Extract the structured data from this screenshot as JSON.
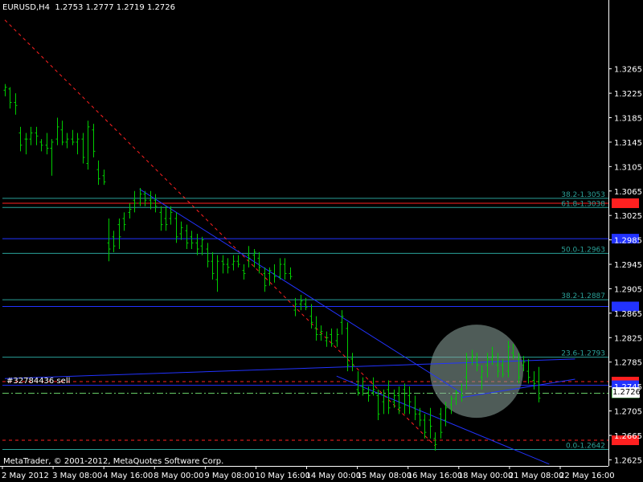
{
  "header": {
    "symbol": "EURUSD,H4",
    "open": "1.2753",
    "high": "1.2777",
    "low": "1.2719",
    "close": "1.2726"
  },
  "copyright": "MetaTrader, © 2001-2012, MetaQuotes Software Corp.",
  "order_label": "#32784436 sell",
  "current_price_label": "1.2726",
  "colors": {
    "background": "#000000",
    "bars": "#00cc00",
    "axis": "#ffffff",
    "fibo_lines": "#2aa198",
    "blue_lines": "#2233ff",
    "red_lines": "#ff2020",
    "highlight_circle": "#8fa8a0"
  },
  "chart_data": {
    "type": "ohlc",
    "symbol": "EURUSD",
    "timeframe": "H4",
    "ylim": [
      1.2615,
      1.3375
    ],
    "y_ticks": [
      "1.3265",
      "1.3225",
      "1.3185",
      "1.3145",
      "1.3105",
      "1.3065",
      "1.3025",
      "1.2985",
      "1.2945",
      "1.2905",
      "1.2865",
      "1.2825",
      "1.2785",
      "1.2745",
      "1.2705",
      "1.2665",
      "1.2625"
    ],
    "x_ticks": [
      "2 May 2012",
      "3 May 08:00",
      "4 May 16:00",
      "8 May 00:00",
      "9 May 08:00",
      "10 May 16:00",
      "14 May 00:00",
      "15 May 08:00",
      "16 May 16:00",
      "18 May 00:00",
      "21 May 08:00",
      "22 May 16:00"
    ],
    "fibonacci_levels": [
      {
        "label": "38.2-1.3053",
        "price": 1.3053
      },
      {
        "label": "61.8-1.3038",
        "price": 1.3038
      },
      {
        "label": "50.0-1.2963",
        "price": 1.2963
      },
      {
        "label": "38.2-1.2887",
        "price": 1.2887
      },
      {
        "label": "23.6-1.2793",
        "price": 1.2793
      },
      {
        "label": "0.0-1.2642",
        "price": 1.2642
      }
    ],
    "horizontal_lines": [
      {
        "price": 1.3045,
        "color": "red",
        "style": "solid"
      },
      {
        "price": 1.2987,
        "color": "blue",
        "style": "solid"
      },
      {
        "price": 1.2876,
        "color": "blue",
        "style": "solid"
      },
      {
        "price": 1.2753,
        "color": "red",
        "style": "dashed"
      },
      {
        "price": 1.2747,
        "color": "blue",
        "style": "solid"
      },
      {
        "price": 1.2734,
        "color": "green",
        "style": "dash-dot"
      },
      {
        "price": 1.2657,
        "color": "red",
        "style": "dashed"
      }
    ],
    "trend_lines": [
      {
        "color": "red",
        "style": "dashed",
        "from": [
          0,
          1.3345
        ],
        "to": [
          83,
          1.2648
        ]
      },
      {
        "color": "blue",
        "style": "solid",
        "from": [
          26,
          1.3068
        ],
        "to": [
          88,
          1.2735
        ]
      },
      {
        "color": "blue",
        "style": "solid",
        "from": [
          0,
          1.2758
        ],
        "to": [
          110,
          1.279
        ]
      },
      {
        "color": "blue",
        "style": "solid",
        "from": [
          64,
          1.2762
        ],
        "to": [
          105,
          1.2618
        ]
      },
      {
        "color": "blue",
        "style": "solid",
        "from": [
          88,
          1.2727
        ],
        "to": [
          110,
          1.2757
        ]
      }
    ],
    "ohlc": [
      [
        1.323,
        1.324,
        1.322,
        1.3235
      ],
      [
        1.3232,
        1.3235,
        1.32,
        1.321
      ],
      [
        1.321,
        1.3225,
        1.319,
        1.3205
      ],
      [
        1.316,
        1.317,
        1.313,
        1.314
      ],
      [
        1.315,
        1.316,
        1.3125,
        1.315
      ],
      [
        1.315,
        1.317,
        1.314,
        1.316
      ],
      [
        1.316,
        1.317,
        1.314,
        1.3155
      ],
      [
        1.3145,
        1.315,
        1.313,
        1.314
      ],
      [
        1.314,
        1.316,
        1.3125,
        1.3135
      ],
      [
        1.3135,
        1.315,
        1.309,
        1.3145
      ],
      [
        1.315,
        1.3185,
        1.314,
        1.317
      ],
      [
        1.3165,
        1.318,
        1.314,
        1.3145
      ],
      [
        1.3145,
        1.316,
        1.3135,
        1.315
      ],
      [
        1.315,
        1.3165,
        1.314,
        1.3145
      ],
      [
        1.3145,
        1.316,
        1.3125,
        1.315
      ],
      [
        1.315,
        1.316,
        1.311,
        1.312
      ],
      [
        1.311,
        1.318,
        1.31,
        1.317
      ],
      [
        1.3165,
        1.3175,
        1.312,
        1.313
      ],
      [
        1.31,
        1.3115,
        1.3075,
        1.3085
      ],
      [
        1.309,
        1.31,
        1.3075,
        1.308
      ],
      [
        1.298,
        1.302,
        1.295,
        1.297
      ],
      [
        1.299,
        1.3,
        1.2965,
        1.2975
      ],
      [
        1.301,
        1.302,
        1.297,
        1.299
      ],
      [
        1.302,
        1.303,
        1.3,
        1.301
      ],
      [
        1.303,
        1.3045,
        1.302,
        1.3035
      ],
      [
        1.305,
        1.3065,
        1.303,
        1.3045
      ],
      [
        1.3045,
        1.307,
        1.304,
        1.306
      ],
      [
        1.306,
        1.3065,
        1.304,
        1.305
      ],
      [
        1.305,
        1.3065,
        1.3035,
        1.3045
      ],
      [
        1.305,
        1.306,
        1.303,
        1.304
      ],
      [
        1.303,
        1.304,
        1.3,
        1.301
      ],
      [
        1.302,
        1.304,
        1.3,
        1.301
      ],
      [
        1.302,
        1.304,
        1.301,
        1.303
      ],
      [
        1.302,
        1.303,
        1.298,
        1.299
      ],
      [
        1.2995,
        1.3015,
        1.2985,
        1.3005
      ],
      [
        1.3,
        1.301,
        1.297,
        1.298
      ],
      [
        1.299,
        1.3,
        1.297,
        1.298
      ],
      [
        1.298,
        1.2995,
        1.296,
        1.297
      ],
      [
        1.2975,
        1.299,
        1.296,
        1.2985
      ],
      [
        1.297,
        1.298,
        1.294,
        1.295
      ],
      [
        1.295,
        1.2965,
        1.292,
        1.293
      ],
      [
        1.292,
        1.296,
        1.29,
        1.295
      ],
      [
        1.295,
        1.296,
        1.293,
        1.2945
      ],
      [
        1.2945,
        1.2955,
        1.293,
        1.294
      ],
      [
        1.2945,
        1.296,
        1.2935,
        1.295
      ],
      [
        1.295,
        1.296,
        1.294,
        1.2945
      ],
      [
        1.2935,
        1.2945,
        1.292,
        1.293
      ],
      [
        1.296,
        1.2975,
        1.294,
        1.2955
      ],
      [
        1.296,
        1.297,
        1.294,
        1.2965
      ],
      [
        1.2955,
        1.2965,
        1.293,
        1.294
      ],
      [
        1.293,
        1.294,
        1.29,
        1.291
      ],
      [
        1.293,
        1.294,
        1.291,
        1.2935
      ],
      [
        1.293,
        1.2945,
        1.2915,
        1.2925
      ],
      [
        1.2925,
        1.2955,
        1.292,
        1.2945
      ],
      [
        1.2945,
        1.2955,
        1.292,
        1.293
      ],
      [
        1.293,
        1.294,
        1.292,
        1.2925
      ],
      [
        1.287,
        1.289,
        1.286,
        1.288
      ],
      [
        1.288,
        1.2895,
        1.287,
        1.2885
      ],
      [
        1.288,
        1.289,
        1.287,
        1.2875
      ],
      [
        1.286,
        1.288,
        1.284,
        1.285
      ],
      [
        1.284,
        1.286,
        1.282,
        1.283
      ],
      [
        1.283,
        1.2845,
        1.282,
        1.2835
      ],
      [
        1.282,
        1.2835,
        1.281,
        1.2825
      ],
      [
        1.283,
        1.284,
        1.281,
        1.2815
      ],
      [
        1.282,
        1.284,
        1.281,
        1.283
      ],
      [
        1.285,
        1.287,
        1.283,
        1.286
      ],
      [
        1.284,
        1.285,
        1.277,
        1.278
      ],
      [
        1.279,
        1.28,
        1.277,
        1.278
      ],
      [
        1.274,
        1.277,
        1.273,
        1.2735
      ],
      [
        1.2745,
        1.276,
        1.273,
        1.274
      ],
      [
        1.2735,
        1.2745,
        1.272,
        1.273
      ],
      [
        1.2735,
        1.276,
        1.273,
        1.274
      ],
      [
        1.273,
        1.274,
        1.269,
        1.27
      ],
      [
        1.272,
        1.274,
        1.27,
        1.273
      ],
      [
        1.274,
        1.2755,
        1.27,
        1.271
      ],
      [
        1.272,
        1.274,
        1.271,
        1.273
      ],
      [
        1.273,
        1.2745,
        1.27,
        1.271
      ],
      [
        1.274,
        1.275,
        1.27,
        1.2715
      ],
      [
        1.273,
        1.2745,
        1.27,
        1.272
      ],
      [
        1.271,
        1.273,
        1.269,
        1.27
      ],
      [
        1.27,
        1.271,
        1.268,
        1.269
      ],
      [
        1.269,
        1.27,
        1.266,
        1.267
      ],
      [
        1.269,
        1.271,
        1.266,
        1.268
      ],
      [
        1.266,
        1.267,
        1.264,
        1.265
      ],
      [
        1.27,
        1.271,
        1.266,
        1.267
      ],
      [
        1.269,
        1.272,
        1.268,
        1.271
      ],
      [
        1.2715,
        1.273,
        1.27,
        1.2725
      ],
      [
        1.2725,
        1.274,
        1.2715,
        1.2735
      ],
      [
        1.274,
        1.275,
        1.272,
        1.273
      ],
      [
        1.276,
        1.28,
        1.274,
        1.279
      ],
      [
        1.279,
        1.2805,
        1.278,
        1.2795
      ],
      [
        1.279,
        1.28,
        1.277,
        1.278
      ],
      [
        1.276,
        1.278,
        1.274,
        1.277
      ],
      [
        1.278,
        1.28,
        1.276,
        1.279
      ],
      [
        1.279,
        1.281,
        1.278,
        1.2795
      ],
      [
        1.278,
        1.28,
        1.276,
        1.277
      ],
      [
        1.278,
        1.279,
        1.276,
        1.2765
      ],
      [
        1.277,
        1.282,
        1.276,
        1.281
      ],
      [
        1.28,
        1.2815,
        1.279,
        1.2795
      ],
      [
        1.279,
        1.28,
        1.275,
        1.276
      ],
      [
        1.278,
        1.2795,
        1.277,
        1.2785
      ],
      [
        1.277,
        1.279,
        1.275,
        1.276
      ],
      [
        1.2755,
        1.277,
        1.274,
        1.275
      ],
      [
        1.2753,
        1.2777,
        1.2719,
        1.2726
      ]
    ]
  }
}
